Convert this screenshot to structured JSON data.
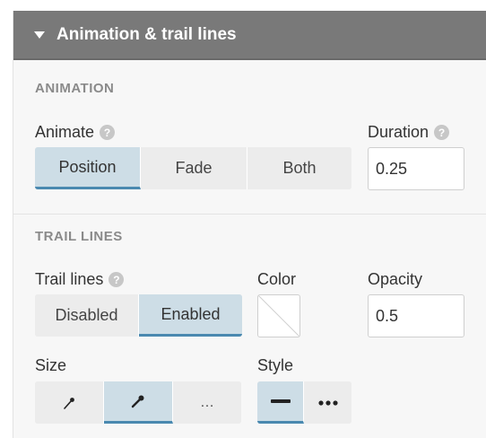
{
  "panel": {
    "title": "Animation & trail lines"
  },
  "animation": {
    "heading": "ANIMATION",
    "animate": {
      "label": "Animate",
      "help": "?",
      "options": [
        "Position",
        "Fade",
        "Both"
      ],
      "selected": "Position"
    },
    "duration": {
      "label": "Duration",
      "help": "?",
      "value": "0.25"
    }
  },
  "trail": {
    "heading": "TRAIL LINES",
    "trail_lines": {
      "label": "Trail lines",
      "help": "?",
      "options": [
        "Disabled",
        "Enabled"
      ],
      "selected": "Enabled"
    },
    "color": {
      "label": "Color",
      "value": "none"
    },
    "opacity": {
      "label": "Opacity",
      "value": "0.5"
    },
    "size": {
      "label": "Size",
      "options": [
        "small-pin-icon",
        "large-pin-icon",
        "…"
      ],
      "selected": "large-pin-icon"
    },
    "style": {
      "label": "Style",
      "options": [
        "solid-line-icon",
        "dotted-line-icon"
      ],
      "selected": "solid-line-icon"
    }
  }
}
